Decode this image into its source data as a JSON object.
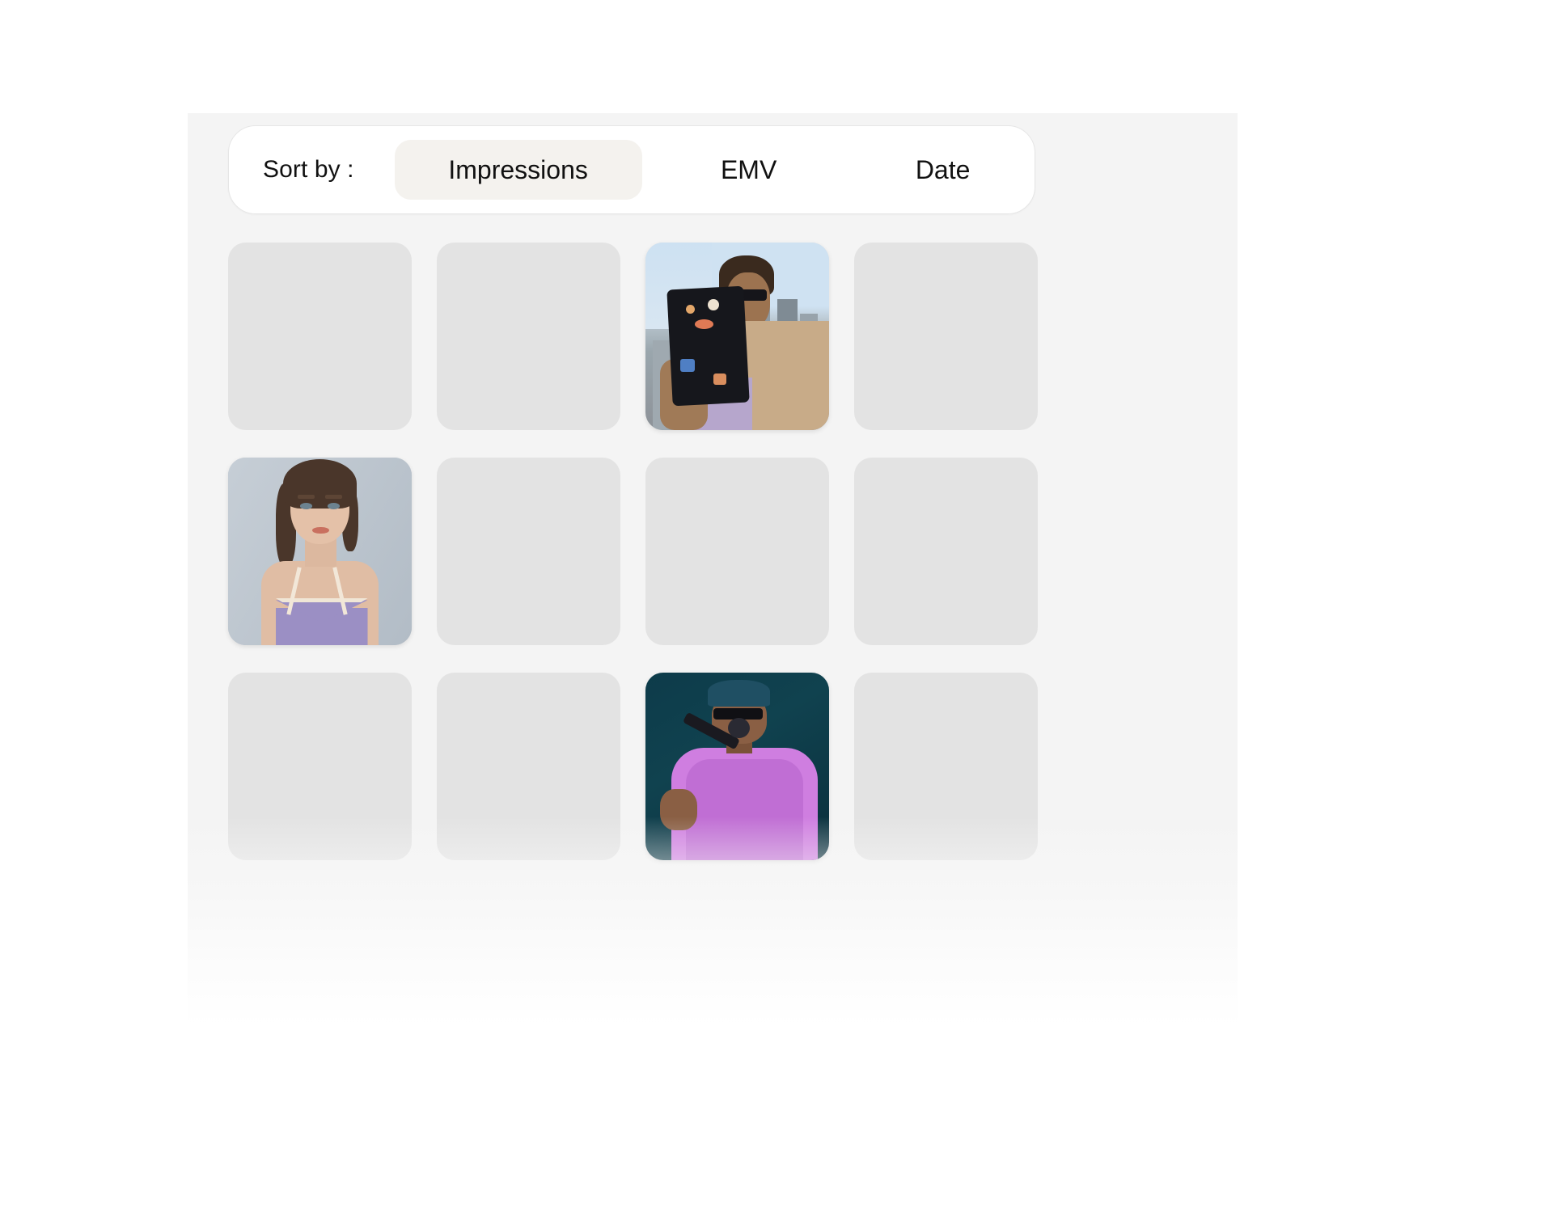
{
  "page": {
    "background_color": "#ffffff",
    "panel_color": "#f4f4f4"
  },
  "sort_bar": {
    "label": "Sort by :",
    "selected_option": "Impressions",
    "selected_pill_color": "#f4f2ee",
    "bar_background": "#ffffff",
    "options": [
      {
        "label": "Impressions",
        "selected": true
      },
      {
        "label": "EMV",
        "selected": false
      },
      {
        "label": "Date",
        "selected": false
      }
    ]
  },
  "grid": {
    "columns": 4,
    "placeholder_color": "#e3e3e3",
    "cards": [
      {
        "type": "placeholder",
        "row": 1,
        "col": 1
      },
      {
        "type": "placeholder",
        "row": 1,
        "col": 2
      },
      {
        "type": "photo",
        "row": 1,
        "col": 3,
        "subject": "man-holding-tablet-city-skyline"
      },
      {
        "type": "placeholder",
        "row": 1,
        "col": 4
      },
      {
        "type": "photo",
        "row": 2,
        "col": 1,
        "subject": "woman-portrait-lavender-slip-dress"
      },
      {
        "type": "placeholder",
        "row": 2,
        "col": 2
      },
      {
        "type": "placeholder",
        "row": 2,
        "col": 3
      },
      {
        "type": "placeholder",
        "row": 2,
        "col": 4
      },
      {
        "type": "placeholder",
        "row": 3,
        "col": 1
      },
      {
        "type": "placeholder",
        "row": 3,
        "col": 2
      },
      {
        "type": "photo",
        "row": 3,
        "col": 3,
        "subject": "singer-with-microphone-purple-shirt"
      },
      {
        "type": "placeholder",
        "row": 3,
        "col": 4
      }
    ]
  }
}
